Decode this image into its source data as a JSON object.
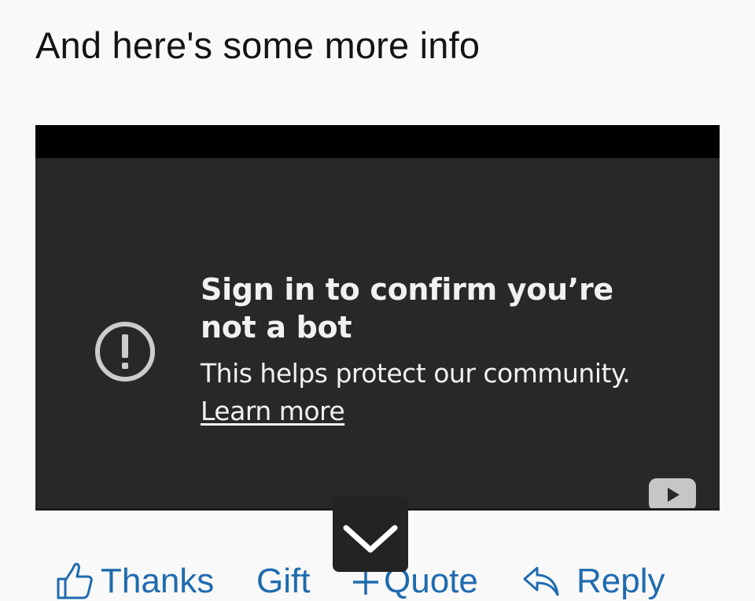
{
  "post": {
    "text": "And here's some more info"
  },
  "video": {
    "title": "Sign in to confirm you’re not a bot",
    "subtitle": "This helps protect our community.",
    "link": "Learn more",
    "alert_icon": "exclamation-circle-icon",
    "logo_icon": "youtube-logo-icon"
  },
  "scroll_button": {
    "icon": "chevron-down-icon"
  },
  "actions": {
    "thanks": "Thanks",
    "gift": "Gift",
    "quote": "Quote",
    "reply": "Reply",
    "thanks_icon": "thumbs-up-icon",
    "quote_icon": "plus-icon",
    "reply_icon": "reply-arrow-icon"
  },
  "colors": {
    "link": "#1f6bb0",
    "video_bg": "#282828",
    "page_bg": "#f9f9f9"
  }
}
